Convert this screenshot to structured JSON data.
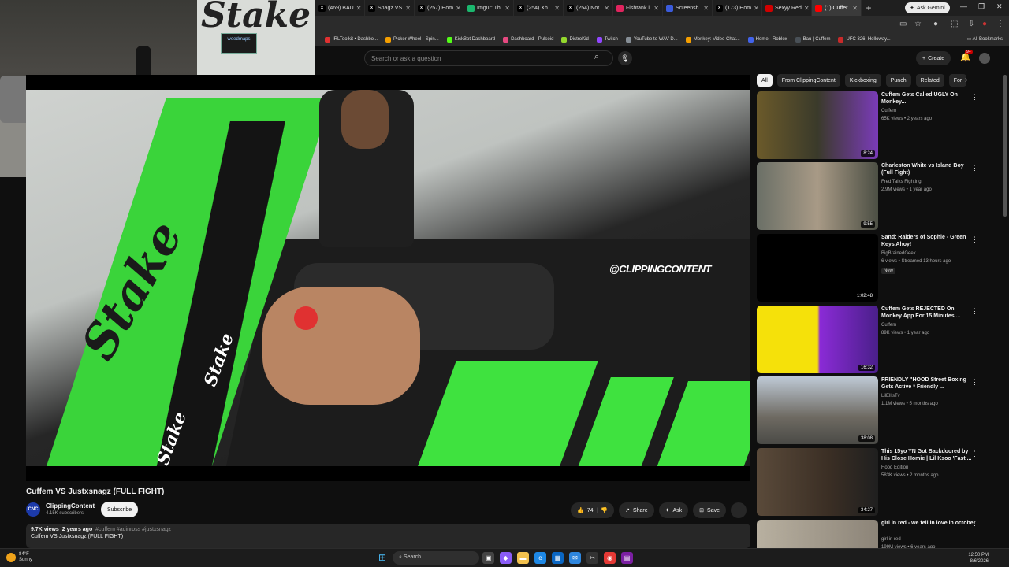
{
  "browser": {
    "tabs": [
      {
        "label": "(469) BAU",
        "color": "#000000",
        "glyph": "X"
      },
      {
        "label": "Snagz VS",
        "color": "#000000",
        "glyph": "X"
      },
      {
        "label": "(257) Hom",
        "color": "#000000",
        "glyph": "X"
      },
      {
        "label": "Imgur: Th",
        "color": "#1bb76e",
        "glyph": ""
      },
      {
        "label": "(254) Xh",
        "color": "#000000",
        "glyph": "X"
      },
      {
        "label": "(254) Not",
        "color": "#000000",
        "glyph": "X"
      },
      {
        "label": "Fishtank.l",
        "color": "#e0245e",
        "glyph": ""
      },
      {
        "label": "Screensh",
        "color": "#3b5bdb",
        "glyph": ""
      },
      {
        "label": "(173) Hom",
        "color": "#000000",
        "glyph": "X"
      },
      {
        "label": "Sexyy Red",
        "color": "#d00000",
        "glyph": ""
      },
      {
        "label": "(1) Cuffer",
        "color": "#ff0000",
        "glyph": ""
      }
    ],
    "ask_gemini": "Ask Gemini",
    "bookmarks": [
      {
        "label": "IRLToolkit • Dashbo...",
        "color": "#e03131"
      },
      {
        "label": "Picker Wheel - Spin...",
        "color": "#f59f00"
      },
      {
        "label": "KickBot Dashboard",
        "color": "#53fc18"
      },
      {
        "label": "Dashboard - Pulsoid",
        "color": "#e64980"
      },
      {
        "label": "DistroKid",
        "color": "#94d82d"
      },
      {
        "label": "Twitch",
        "color": "#9146ff"
      },
      {
        "label": "YouTube to WAV D...",
        "color": "#868e96"
      },
      {
        "label": "Monkey: Video Chat...",
        "color": "#f59f00"
      },
      {
        "label": "Home - Roblox",
        "color": "#4263eb"
      },
      {
        "label": "Bau | Cuffem",
        "color": "#495057"
      },
      {
        "label": "UFC 326: Holloway...",
        "color": "#c92a2a"
      }
    ],
    "all_bookmarks": "All Bookmarks"
  },
  "youtube": {
    "search_placeholder": "Search or ask a question",
    "create_label": "Create",
    "notif_count": "9+"
  },
  "webcam": {
    "sign_text": "weedmaps"
  },
  "video": {
    "title": "Cuffem VS Justxsnagz (FULL FIGHT)",
    "watermark": "@CLIPPINGCONTENT",
    "channel": "ClippingContent",
    "avatar_text": "CNC",
    "subscribers": "4.15K subscribers",
    "subscribe_label": "Subscribe",
    "likes": "74",
    "share_label": "Share",
    "ask_label": "Ask",
    "save_label": "Save",
    "views": "9.7K views",
    "age": "2 years ago",
    "tags": "#cuffem #adinross #justxsnagz",
    "description": "Cuffem VS Justxsnagz (FULL FIGHT)"
  },
  "chips": [
    "All",
    "From ClippingContent",
    "Kickboxing",
    "Punch",
    "Related",
    "For"
  ],
  "recommended": [
    {
      "title": "Cuffem Gets Called UGLY On Monkey...",
      "channel": "Cuffem",
      "meta": "65K views • 2 years ago",
      "duration": "8:24",
      "bg": "linear-gradient(90deg,#6b5a2a 0%,#3a3a2a 50%,#7a3bb8 100%)",
      "badge": ""
    },
    {
      "title": "Charleston White vs Island Boy (Full Fight)",
      "channel": "Fred Talks Fighting",
      "meta": "2.9M views • 1 year ago",
      "duration": "9:55",
      "bg": "linear-gradient(90deg,#6a6f66 0%,#a89a86 50%,#4c4f44 100%)",
      "badge": ""
    },
    {
      "title": "Sand: Raiders of Sophie - Green Keys Ahoy!",
      "channel": "BigBrainedGeek",
      "meta": "6 views • Streamed 13 hours ago",
      "duration": "1:02:48",
      "bg": "#000000",
      "badge": "New"
    },
    {
      "title": "Cuffem Gets REJECTED On Monkey App For 15 Minutes ...",
      "channel": "Cuffem",
      "meta": "89K views • 1 year ago",
      "duration": "16:32",
      "bg": "linear-gradient(90deg,#f5e10a 0%,#f5e10a 50%,#8a2bd6 52%,#4a1f8a 100%)",
      "badge": ""
    },
    {
      "title": "FRIENDLY \"HOOD Street Boxing Gets Active * Friendly ...",
      "channel": "LilEllisTv",
      "meta": "1.1M views • 5 months ago",
      "duration": "38:08",
      "bg": "linear-gradient(180deg,#bfcad6 0%,#6e6a62 60%,#4a4a46 100%)",
      "badge": ""
    },
    {
      "title": "This 15yo YN Got Backdoored by His Close Homie | Lil Ksoo 'Fast ...",
      "channel": "Hood Edition",
      "meta": "583K views • 2 months ago",
      "duration": "34:27",
      "bg": "linear-gradient(90deg,#5a4a3a 0%,#3a2e24 60%,#1f1f1f 100%)",
      "badge": ""
    },
    {
      "title": "girl in red - we fell in love in october",
      "channel": "girl in red",
      "meta": "199M views • 6 years ago",
      "duration": "",
      "bg": "linear-gradient(90deg,#b8b0a0 0%,#8c8478 100%)",
      "badge": ""
    }
  ],
  "taskbar": {
    "temp": "84°F",
    "weather": "Sunny",
    "search": "Search",
    "time": "12:50 PM",
    "date": "8/6/2026"
  }
}
